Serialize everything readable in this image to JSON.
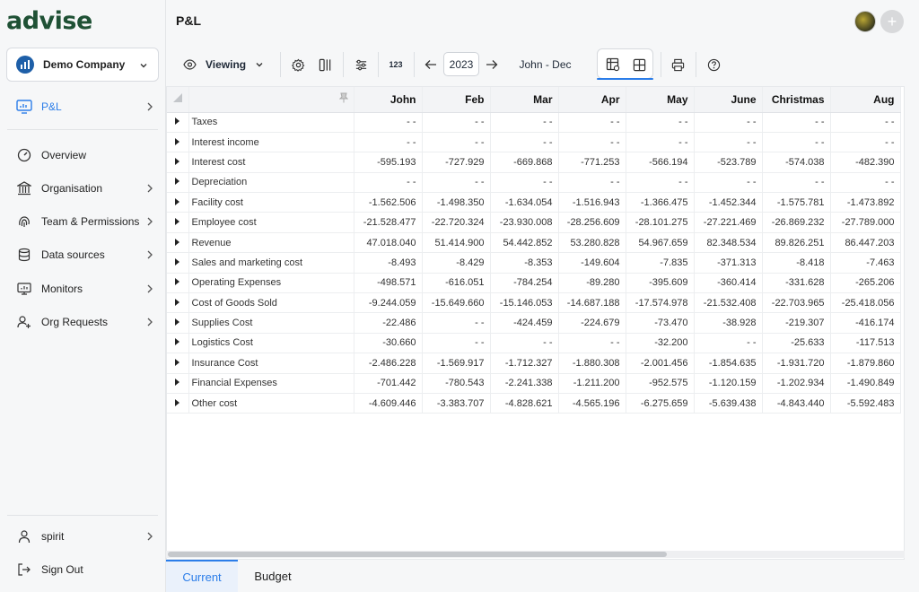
{
  "app": {
    "logo": "advise"
  },
  "company": {
    "name": "Demo Company"
  },
  "sidebar": {
    "primary": [
      {
        "label": "P&L",
        "icon": "monitor-chart-icon",
        "active": true
      }
    ],
    "items": [
      {
        "label": "Overview",
        "icon": "gauge-icon"
      },
      {
        "label": "Organisation",
        "icon": "bank-icon"
      },
      {
        "label": "Team & Permissions",
        "icon": "fingerprint-icon"
      },
      {
        "label": "Data sources",
        "icon": "database-icon"
      },
      {
        "label": "Monitors",
        "icon": "monitor-icon"
      },
      {
        "label": "Org Requests",
        "icon": "user-plus-icon"
      }
    ],
    "bottom": [
      {
        "label": "spirit",
        "icon": "user-icon"
      },
      {
        "label": "Sign Out",
        "icon": "sign-out-icon"
      }
    ]
  },
  "header": {
    "title": "P&L"
  },
  "toolbar": {
    "viewing_label": "Viewing",
    "number_format_label": "123",
    "year": "2023",
    "period": "John - Dec"
  },
  "table": {
    "columns": [
      "John",
      "Feb",
      "Mar",
      "Apr",
      "May",
      "June",
      "Christmas",
      "Aug"
    ],
    "rows": [
      {
        "name": "Taxes",
        "values": [
          "- -",
          "- -",
          "- -",
          "- -",
          "- -",
          "- -",
          "- -",
          "- -"
        ]
      },
      {
        "name": "Interest income",
        "values": [
          "- -",
          "- -",
          "- -",
          "- -",
          "- -",
          "- -",
          "- -",
          "- -"
        ]
      },
      {
        "name": "Interest cost",
        "values": [
          "-595.193",
          "-727.929",
          "-669.868",
          "-771.253",
          "-566.194",
          "-523.789",
          "-574.038",
          "-482.390"
        ]
      },
      {
        "name": "Depreciation",
        "values": [
          "- -",
          "- -",
          "- -",
          "- -",
          "- -",
          "- -",
          "- -",
          "- -"
        ]
      },
      {
        "name": "Facility cost",
        "values": [
          "-1.562.506",
          "-1.498.350",
          "-1.634.054",
          "-1.516.943",
          "-1.366.475",
          "-1.452.344",
          "-1.575.781",
          "-1.473.892"
        ]
      },
      {
        "name": "Employee cost",
        "values": [
          "-21.528.477",
          "-22.720.324",
          "-23.930.008",
          "-28.256.609",
          "-28.101.275",
          "-27.221.469",
          "-26.869.232",
          "-27.789.000"
        ]
      },
      {
        "name": "Revenue",
        "values": [
          "47.018.040",
          "51.414.900",
          "54.442.852",
          "53.280.828",
          "54.967.659",
          "82.348.534",
          "89.826.251",
          "86.447.203"
        ]
      },
      {
        "name": "Sales and marketing cost",
        "values": [
          "-8.493",
          "-8.429",
          "-8.353",
          "-149.604",
          "-7.835",
          "-371.313",
          "-8.418",
          "-7.463"
        ]
      },
      {
        "name": "Operating Expenses",
        "values": [
          "-498.571",
          "-616.051",
          "-784.254",
          "-89.280",
          "-395.609",
          "-360.414",
          "-331.628",
          "-265.206"
        ]
      },
      {
        "name": "Cost of Goods Sold",
        "values": [
          "-9.244.059",
          "-15.649.660",
          "-15.146.053",
          "-14.687.188",
          "-17.574.978",
          "-21.532.408",
          "-22.703.965",
          "-25.418.056"
        ]
      },
      {
        "name": "Supplies Cost",
        "values": [
          "-22.486",
          "- -",
          "-424.459",
          "-224.679",
          "-73.470",
          "-38.928",
          "-219.307",
          "-416.174"
        ]
      },
      {
        "name": "Logistics Cost",
        "values": [
          "-30.660",
          "- -",
          "- -",
          "- -",
          "-32.200",
          "- -",
          "-25.633",
          "-117.513"
        ]
      },
      {
        "name": "Insurance Cost",
        "values": [
          "-2.486.228",
          "-1.569.917",
          "-1.712.327",
          "-1.880.308",
          "-2.001.456",
          "-1.854.635",
          "-1.931.720",
          "-1.879.860"
        ]
      },
      {
        "name": "Financial Expenses",
        "values": [
          "-701.442",
          "-780.543",
          "-2.241.338",
          "-1.211.200",
          "-952.575",
          "-1.120.159",
          "-1.202.934",
          "-1.490.849"
        ]
      },
      {
        "name": "Other cost",
        "values": [
          "-4.609.446",
          "-3.383.707",
          "-4.828.621",
          "-4.565.196",
          "-6.275.659",
          "-5.639.438",
          "-4.843.440",
          "-5.592.483"
        ]
      }
    ]
  },
  "tabs": [
    {
      "label": "Current",
      "active": true
    },
    {
      "label": "Budget",
      "active": false
    }
  ]
}
